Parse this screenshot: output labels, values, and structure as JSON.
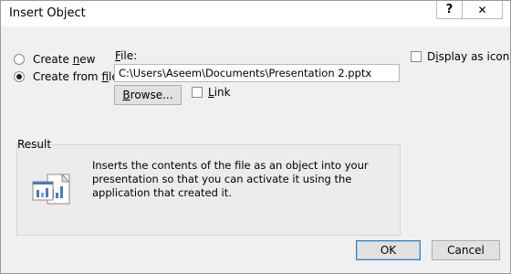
{
  "window": {
    "title": "Insert Object",
    "help_glyph": "?",
    "close_glyph": "✕"
  },
  "source": {
    "create_new": {
      "prefix": "Create ",
      "hotkey": "n",
      "suffix": "ew",
      "selected": false
    },
    "create_from_file": {
      "prefix": "Create from ",
      "hotkey": "f",
      "suffix": "ile",
      "selected": true
    }
  },
  "file": {
    "label_hotkey": "F",
    "label_rest": "ile:",
    "value": "C:\\Users\\Aseem\\Documents\\Presentation 2.pptx"
  },
  "browse_button": {
    "hotkey": "B",
    "rest": "rowse..."
  },
  "link": {
    "hotkey": "L",
    "rest": "ink",
    "checked": false
  },
  "display_as_icon": {
    "prefix": "D",
    "hotkey": "i",
    "rest": "splay as icon",
    "checked": false
  },
  "result": {
    "label": "Result",
    "text": "Inserts the contents of the file as an object into your presentation so that you can activate it using the application that created it."
  },
  "buttons": {
    "ok": "OK",
    "cancel": "Cancel"
  },
  "icons": {
    "help": "help-icon",
    "close": "close-icon",
    "result": "document-chart-icon"
  }
}
